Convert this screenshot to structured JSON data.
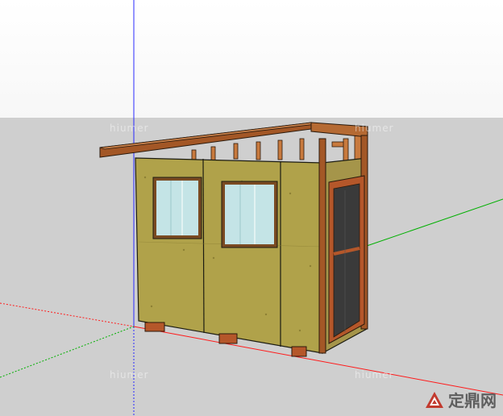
{
  "viewport": {
    "watermarks": [
      "hiumer",
      "hiumer",
      "hiumer",
      "hiumer"
    ],
    "brand": {
      "name": "定鼎网",
      "icon": "ding-logo-icon"
    },
    "colors": {
      "sky": "#ffffff",
      "ground": "#cfcfcf",
      "axis_blue": "#2a2aff",
      "axis_red": "#ff1a1a",
      "axis_green": "#00b000",
      "plywood": "#b0a24a",
      "timber": "#b5572a"
    }
  }
}
